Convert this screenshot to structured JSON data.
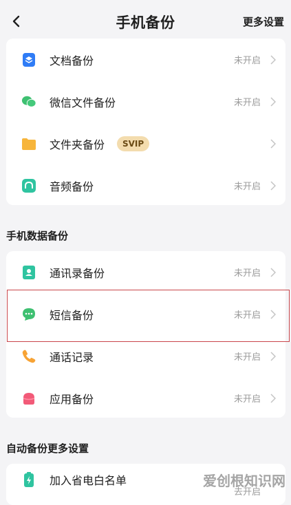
{
  "header": {
    "title": "手机备份",
    "more_settings": "更多设置"
  },
  "file_backup": {
    "items": [
      {
        "label": "文档备份",
        "status": "未开启",
        "icon": "document-icon",
        "color": "#2f7cf6"
      },
      {
        "label": "微信文件备份",
        "status": "未开启",
        "icon": "wechat-icon",
        "color": "#3ec071"
      },
      {
        "label": "文件夹备份",
        "status": "",
        "icon": "folder-icon",
        "color": "#f7b53b",
        "badge": "SVIP"
      },
      {
        "label": "音频备份",
        "status": "未开启",
        "icon": "audio-icon",
        "color": "#2fc4a0"
      }
    ]
  },
  "phone_data_backup": {
    "title": "手机数据备份",
    "items": [
      {
        "label": "通讯录备份",
        "status": "未开启",
        "icon": "contacts-icon",
        "color": "#2fc4a0"
      },
      {
        "label": "短信备份",
        "status": "未开启",
        "icon": "message-icon",
        "color": "#3ec071",
        "highlighted": true
      },
      {
        "label": "通话记录",
        "status": "未开启",
        "icon": "phone-icon",
        "color": "#f7a335"
      },
      {
        "label": "应用备份",
        "status": "未开启",
        "icon": "app-icon",
        "color": "#f25a78"
      }
    ]
  },
  "auto_backup": {
    "title": "自动备份更多设置",
    "items": [
      {
        "label": "加入省电白名单",
        "status": "去开启",
        "icon": "battery-icon",
        "color": "#2fc4a0"
      }
    ]
  },
  "watermark": "爱创根知识网"
}
